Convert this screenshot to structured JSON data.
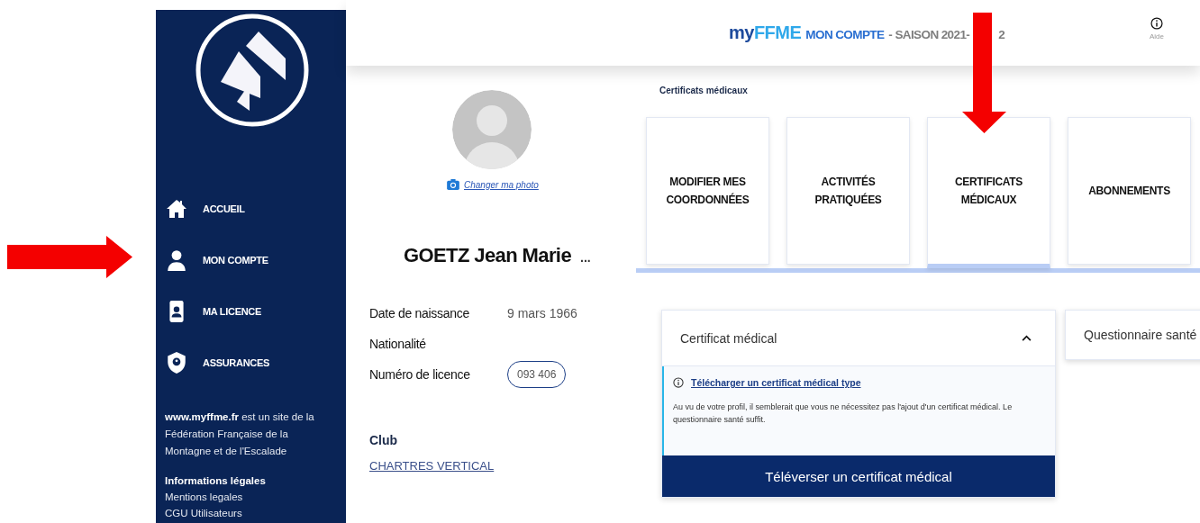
{
  "header": {
    "brand_prefix": "my",
    "brand": "FFME",
    "section": "MON COMPTE",
    "season": "- SAISON 2021-",
    "season_tail": "2",
    "help": "Aide"
  },
  "sidebar": {
    "items": [
      {
        "label": "ACCUEIL",
        "kind": "home",
        "annotated": false
      },
      {
        "label": "MON COMPTE",
        "kind": "person",
        "annotated": true
      },
      {
        "label": "MA LICENCE",
        "kind": "card",
        "annotated": false
      },
      {
        "label": "ASSURANCES",
        "kind": "shield",
        "annotated": false
      }
    ],
    "about": "**www.myffme.fr** est un site de la Fédération Française de la Montagne et de l'Escalade",
    "legal_title": "Informations légales",
    "legal_links": [
      "Mentions legales",
      "CGU Utilisateurs"
    ]
  },
  "profile": {
    "change_photo": "Changer ma photo",
    "name": "GOETZ Jean Marie",
    "more": "...",
    "fields": [
      {
        "label": "Date de naissance",
        "value": "9 mars 1966",
        "kind": "text"
      },
      {
        "label": "Nationalité"
      },
      {
        "label": "Numéro de licence",
        "value": "093 406",
        "kind": "pill"
      }
    ],
    "club_label": "Club",
    "club": "CHARTRES VERTICAL"
  },
  "content": {
    "section_title": "Certificats médicaux",
    "tabs": [
      {
        "label": "MODIFIER MES COORDONNÉES",
        "selected": false,
        "annotated": false
      },
      {
        "label": "ACTIVITÉS PRATIQUÉES",
        "selected": false,
        "annotated": false
      },
      {
        "label": "CERTIFICATS MÉDICAUX",
        "selected": true,
        "annotated": true
      },
      {
        "label": "ABONNEMENTS",
        "selected": false,
        "annotated": false
      }
    ],
    "accordion": {
      "title": "Certificat médical",
      "expanded": true,
      "download_link": "Télécharger un certificat médical type",
      "message": "Au vu de votre profil, il semblerait que vous ne nécessitez pas l'ajout d'un certificat médical. Le questionnaire santé suffit.",
      "upload_button": "Téléverser un certificat médical"
    },
    "side_card": "Questionnaire santé"
  }
}
